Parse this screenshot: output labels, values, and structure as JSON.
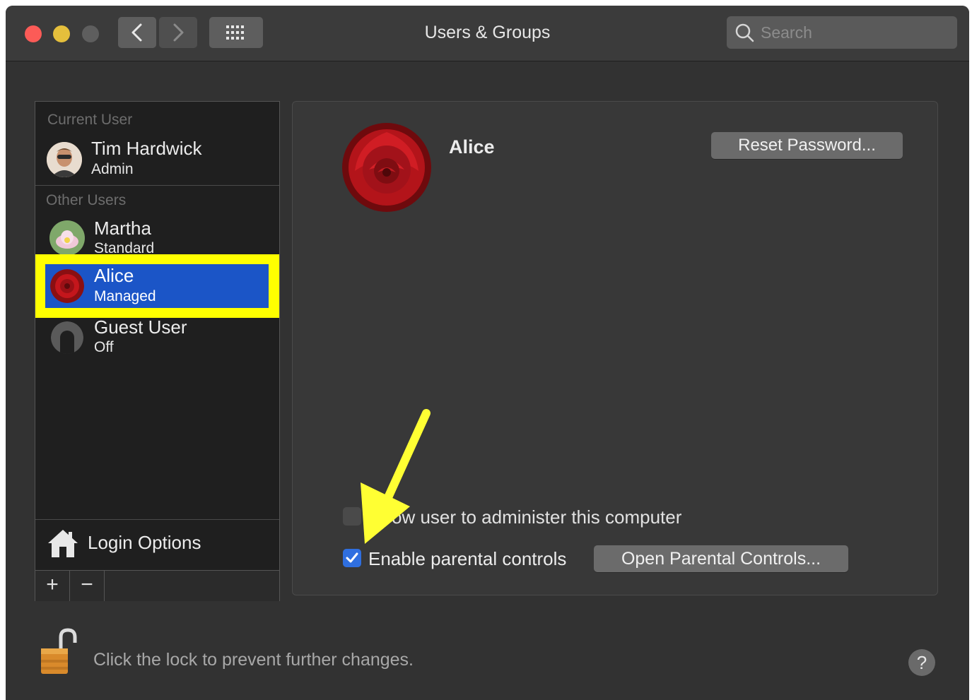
{
  "window": {
    "title": "Users & Groups"
  },
  "toolbar": {
    "search_placeholder": "Search"
  },
  "sidebar": {
    "current_user_label": "Current User",
    "current_user": {
      "name": "Tim Hardwick",
      "role": "Admin"
    },
    "other_users_label": "Other Users",
    "other_users": [
      {
        "name": "Martha",
        "role": "Standard"
      },
      {
        "name": "Alice",
        "role": "Managed"
      },
      {
        "name": "Guest User",
        "role": "Off"
      }
    ],
    "login_options_label": "Login Options",
    "add_label": "+",
    "remove_label": "−"
  },
  "detail": {
    "user_name": "Alice",
    "reset_password_label": "Reset Password...",
    "allow_admin_label": "ow user to administer this computer",
    "enable_parental_label": "Enable parental controls",
    "enable_parental_checked": true,
    "open_parental_label": "Open Parental Controls..."
  },
  "footer": {
    "lock_text": "Click the lock to prevent further changes.",
    "help_label": "?"
  },
  "colors": {
    "selection_blue": "#1b55c7",
    "highlight_yellow": "#ffff00",
    "checkbox_blue": "#2f6fe0"
  }
}
